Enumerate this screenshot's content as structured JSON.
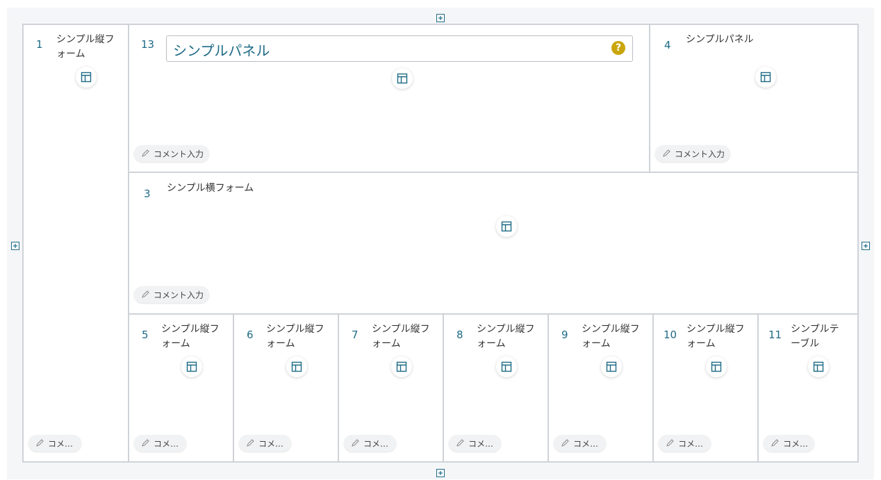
{
  "cells": [
    {
      "num": "1",
      "title_l1": "シンプル縦フ",
      "title_l2": "ォーム",
      "comment": "コメ…"
    },
    {
      "num": "13",
      "panel_title": "シンプルパネル",
      "help": "?",
      "comment": "コメント入力"
    },
    {
      "num": "4",
      "title_l1": "シンプルパネル",
      "comment": "コメント入力"
    },
    {
      "num": "3",
      "title_l1": "シンプル横フォーム",
      "comment": "コメント入力"
    },
    {
      "num": "5",
      "title_l1": "シンプル縦フ",
      "title_l2": "ォーム",
      "comment": "コメ…"
    },
    {
      "num": "6",
      "title_l1": "シンプル縦フ",
      "title_l2": "ォーム",
      "comment": "コメ…"
    },
    {
      "num": "7",
      "title_l1": "シンプル縦フ",
      "title_l2": "ォーム",
      "comment": "コメ…"
    },
    {
      "num": "8",
      "title_l1": "シンプル縦フ",
      "title_l2": "ォーム",
      "comment": "コメ…"
    },
    {
      "num": "9",
      "title_l1": "シンプル縦フ",
      "title_l2": "ォーム",
      "comment": "コメ…"
    },
    {
      "num": "10",
      "title_l1": "シンプル縦フ",
      "title_l2": "ォーム",
      "comment": "コメ…"
    },
    {
      "num": "11",
      "title_l1": "シンプルテ",
      "title_l2": "ーブル",
      "comment": "コメ…"
    }
  ],
  "colors": {
    "accent": "#1d6a86",
    "border": "#cfd3d7",
    "help": "#c9a60c"
  },
  "icons": {
    "layout": "layout-icon",
    "add": "add-square-icon",
    "comment": "pencil-icon"
  }
}
